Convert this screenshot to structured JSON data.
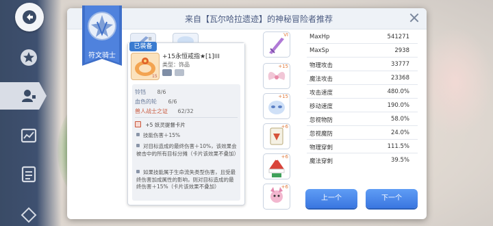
{
  "dialog": {
    "title": "来自【瓦尔哈拉遗迹】的神秘冒险者推荐"
  },
  "class_badge": {
    "label": "符文骑士"
  },
  "equipped_item": {
    "badge": "已装备",
    "name": "+15永恒戒指★[1]III",
    "type_label": "类型：饰品",
    "set_bonuses": [
      {
        "name": "铃铛",
        "value": "8/6",
        "highlight": false
      },
      {
        "name": "血色的轮",
        "value": "6/6",
        "highlight": false
      },
      {
        "name": "兽人战士之证",
        "value": "62/32",
        "highlight": true
      }
    ],
    "card_line": "+5 妖灵提督卡片",
    "effect_1": "技能伤害＋15%",
    "effect_2": "对目标造成的最终伤害＋10%，该效果会被击中的所有目标分摊（卡片该效果不叠加）",
    "effect_3": "如果技能属于生命流失类型伤害，且受最终伤害加成属性的影响，则对目标造成的最终伤害＋15%（卡片该效果不叠加）"
  },
  "slot_thumbs": [
    {
      "name": "sword",
      "plus": "VI"
    },
    {
      "name": "wings",
      "plus": "+15"
    },
    {
      "name": "mask",
      "plus": "+15"
    },
    {
      "name": "card",
      "plus": "+6"
    },
    {
      "name": "hat",
      "plus": "+6"
    },
    {
      "name": "pet",
      "plus": "+6"
    }
  ],
  "stats": [
    {
      "label": "MaxHp",
      "value": "541271"
    },
    {
      "label": "MaxSp",
      "value": "2938"
    },
    {
      "label": "物理攻击",
      "value": "33777"
    },
    {
      "label": "魔法攻击",
      "value": "23368"
    },
    {
      "label": "攻击速度",
      "value": "480.0%"
    },
    {
      "label": "移动速度",
      "value": "190.0%"
    },
    {
      "label": "忽视物防",
      "value": "58.0%"
    },
    {
      "label": "忽视魔防",
      "value": "24.0%"
    },
    {
      "label": "物理穿刺",
      "value": "111.5%"
    },
    {
      "label": "魔法穿刺",
      "value": "39.5%"
    }
  ],
  "buttons": {
    "prev": "上一个",
    "next": "下一个"
  },
  "colors": {
    "accent": "#3a76e0",
    "ribbon": "#3e6fc9",
    "set_highlight": "#c9563b"
  }
}
